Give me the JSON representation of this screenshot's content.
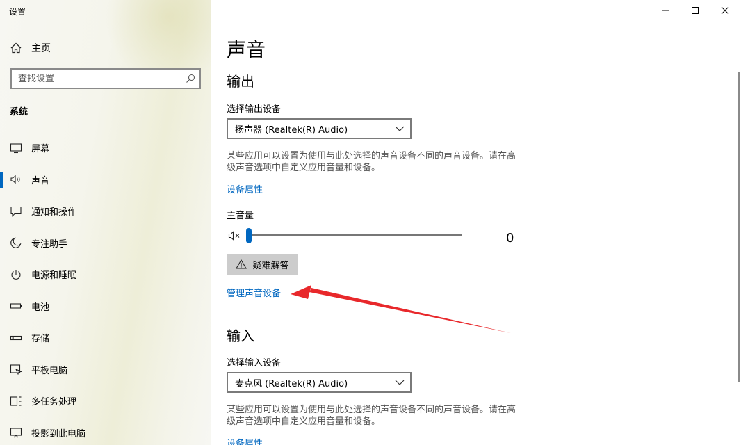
{
  "window": {
    "title": "设置"
  },
  "sidebar": {
    "home_label": "主页",
    "search_placeholder": "查找设置",
    "section_label": "系统",
    "items": [
      {
        "label": "屏幕",
        "icon": "monitor-icon"
      },
      {
        "label": "声音",
        "icon": "speaker-icon",
        "active": true
      },
      {
        "label": "通知和操作",
        "icon": "notification-icon"
      },
      {
        "label": "专注助手",
        "icon": "moon-icon"
      },
      {
        "label": "电源和睡眠",
        "icon": "power-icon"
      },
      {
        "label": "电池",
        "icon": "battery-icon"
      },
      {
        "label": "存储",
        "icon": "storage-icon"
      },
      {
        "label": "平板电脑",
        "icon": "tablet-icon"
      },
      {
        "label": "多任务处理",
        "icon": "multitask-icon"
      },
      {
        "label": "投影到此电脑",
        "icon": "projection-icon"
      }
    ]
  },
  "main": {
    "page_title": "声音",
    "output": {
      "heading": "输出",
      "device_label": "选择输出设备",
      "device_value": "扬声器 (Realtek(R) Audio)",
      "description_line1": "某些应用可以设置为使用与此处选择的声音设备不同的声音设备。请在高",
      "description_line2": "级声音选项中自定义应用音量和设备。",
      "properties_link": "设备属性",
      "master_volume_label": "主音量",
      "volume_value": "0",
      "troubleshoot_label": "疑难解答",
      "manage_link": "管理声音设备"
    },
    "input": {
      "heading": "输入",
      "device_label": "选择输入设备",
      "device_value": "麦克风 (Realtek(R) Audio)",
      "description_line1": "某些应用可以设置为使用与此处选择的声音设备不同的声音设备。请在高",
      "description_line2": "级声音选项中自定义应用音量和设备。",
      "properties_link": "设备属性"
    }
  },
  "colors": {
    "accent": "#0067c0",
    "annotation_arrow": "#e8282b"
  }
}
